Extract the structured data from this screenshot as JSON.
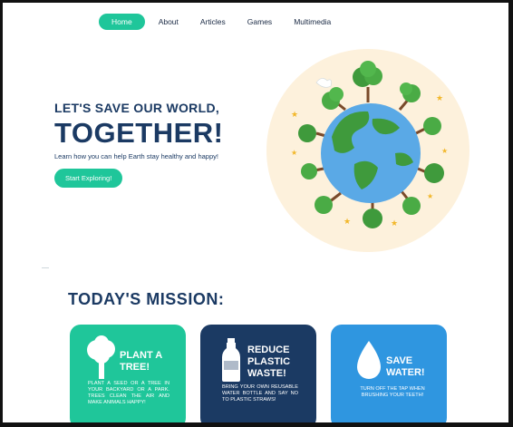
{
  "nav": {
    "items": [
      {
        "label": "Home",
        "active": true
      },
      {
        "label": "About",
        "active": false
      },
      {
        "label": "Articles",
        "active": false
      },
      {
        "label": "Games",
        "active": false
      },
      {
        "label": "Multimedia",
        "active": false
      }
    ]
  },
  "hero": {
    "subtitle": "LET'S SAVE OUR WORLD,",
    "title": "TOGETHER!",
    "description": "Learn how you can help Earth stay healthy and happy!",
    "cta_label": "Start Exploring!"
  },
  "mission": {
    "title": "TODAY'S  MISSION:",
    "cards": [
      {
        "heading": "PLANT A TREE!",
        "body": "PLANT A SEED OR A TREE IN YOUR BACKYARD OR A PARK. TREES CLEAN THE AIR AND MAKE ANIMALS HAPPY!",
        "icon": "tree-icon"
      },
      {
        "heading": "REDUCE PLASTIC WASTE!",
        "body": "BRING YOUR OWN REUSABLE WATER BOTTLE AND SAY NO TO PLASTIC STRAWS!",
        "icon": "bottle-icon"
      },
      {
        "heading": "SAVE WATER!",
        "body": "TURN OFF THE TAP WHEN BRUSHING YOUR TEETH!",
        "icon": "water-drop-icon"
      }
    ]
  },
  "colors": {
    "accent": "#1fc69a",
    "navy": "#1b3a63",
    "blue": "#2f96e0",
    "earth_bg": "#fdf1dc"
  }
}
